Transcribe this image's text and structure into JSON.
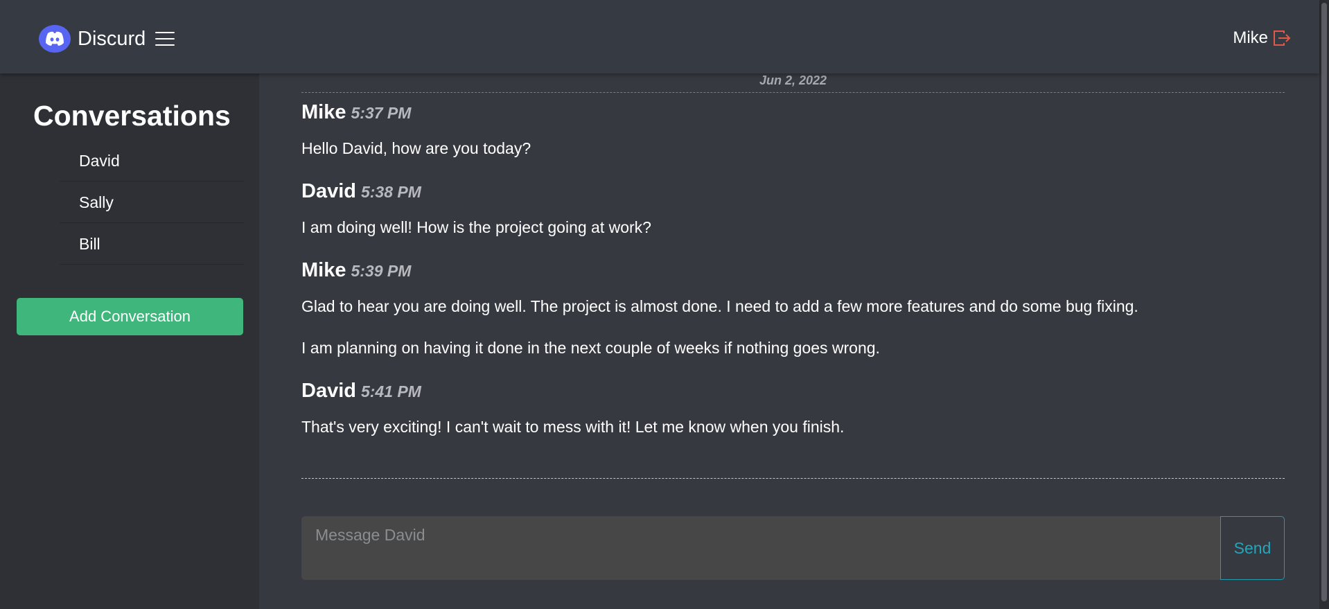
{
  "navbar": {
    "brand": "Discurd",
    "logo_icon": "discord-logo-icon",
    "menu_icon": "hamburger-menu-icon",
    "user_name": "Mike",
    "logout_icon": "logout-icon",
    "logout_color": "#e05a47"
  },
  "sidebar": {
    "title": "Conversations",
    "conversations": [
      {
        "name": "David"
      },
      {
        "name": "Sally"
      },
      {
        "name": "Bill"
      }
    ],
    "add_button": "Add Conversation",
    "add_button_color": "#3fb67b"
  },
  "chat": {
    "date": "Jun 2, 2022",
    "messages": [
      {
        "author": "Mike",
        "time": "5:37 PM",
        "lines": [
          "Hello David, how are you today?"
        ]
      },
      {
        "author": "David",
        "time": "5:38 PM",
        "lines": [
          "I am doing well! How is the project going at work?"
        ]
      },
      {
        "author": "Mike",
        "time": "5:39 PM",
        "lines": [
          "Glad to hear you are doing well. The project is almost done. I need to add a few more features and do some bug fixing.",
          "I am planning on having it done in the next couple of weeks if nothing goes wrong."
        ]
      },
      {
        "author": "David",
        "time": "5:41 PM",
        "lines": [
          "That's very exciting! I can't wait to mess with it! Let me know when you finish."
        ]
      }
    ],
    "composer": {
      "placeholder": "Message David",
      "value": "",
      "send_label": "Send",
      "send_color": "#22a6bb"
    }
  }
}
